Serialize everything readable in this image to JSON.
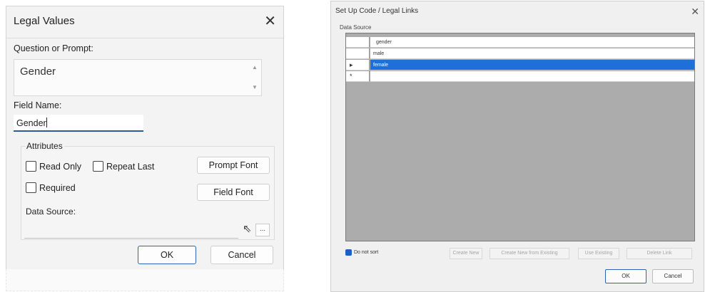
{
  "left_dialog": {
    "title": "Legal Values",
    "close_icon": "close-icon",
    "question_label": "Question or Prompt:",
    "question_value": "Gender",
    "field_name_label": "Field Name:",
    "field_name_value": "Gender",
    "attributes_label": "Attributes",
    "read_only_label": "Read Only",
    "repeat_last_label": "Repeat Last",
    "required_label": "Required",
    "prompt_font_label": "Prompt Font",
    "field_font_label": "Field Font",
    "data_source_label": "Data Source:",
    "browse_label": "...",
    "ok_label": "OK",
    "cancel_label": "Cancel"
  },
  "right_dialog": {
    "title": "Set Up Code / Legal Links",
    "close_icon": "close-icon",
    "data_source_label": "Data Source",
    "rows": [
      {
        "marker": "",
        "value": "gender",
        "selected": false
      },
      {
        "marker": "",
        "value": "male",
        "selected": false
      },
      {
        "marker": "▸",
        "value": "female",
        "selected": true
      },
      {
        "marker": "*",
        "value": "",
        "selected": false
      }
    ],
    "do_not_sort_label": "Do not sort",
    "create_new_label": "Create New",
    "create_new_existing_label": "Create New from Existing",
    "use_existing_label": "Use Existing",
    "delete_link_label": "Delete Link",
    "ok_label": "OK",
    "cancel_label": "Cancel"
  },
  "colors": {
    "accent": "#2b65b5",
    "selection": "#1e6fd9",
    "grid_background": "#acacac"
  }
}
